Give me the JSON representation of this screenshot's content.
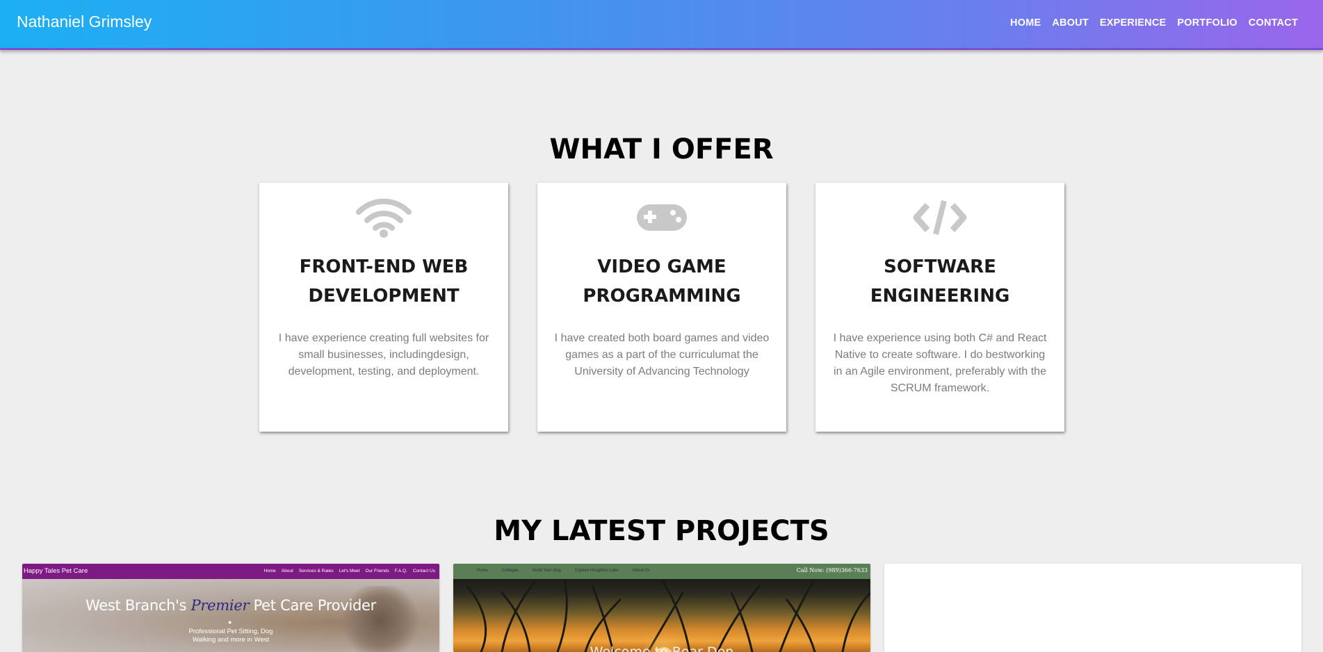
{
  "header": {
    "brand": "Nathaniel Grimsley",
    "nav": [
      "HOME",
      "ABOUT",
      "EXPERIENCE",
      "PORTFOLIO",
      "CONTACT"
    ]
  },
  "offer": {
    "title": "WHAT I OFFER",
    "cards": [
      {
        "icon": "wifi-icon",
        "title_line1": "FRONT-END WEB",
        "title_line2": "DEVELOPMENT",
        "text": "I have experience creating full websites for small businesses, includingdesign, development, testing, and deployment."
      },
      {
        "icon": "gamepad-icon",
        "title_line1": "VIDEO GAME",
        "title_line2": "PROGRAMMING",
        "text": "I have created both board games and video games as a part of the curriculumat the University of Advancing Technology"
      },
      {
        "icon": "code-icon",
        "title_line1": "SOFTWARE",
        "title_line2": "ENGINEERING",
        "text": "I have experience using both C# and React Native to create software. I do bestworking in an Agile environment, preferably with the SCRUM framework."
      }
    ]
  },
  "projects": {
    "title": "MY LATEST PROJECTS",
    "p1": {
      "brand": "Happy Tales Pet Care",
      "nav": [
        "Home",
        "About",
        "Services & Rates",
        "Let's Meet",
        "Our Friends",
        "F.A.Q.",
        "Contact Us"
      ],
      "headline_pre": "West Branch's ",
      "headline_em": "Premier",
      "headline_post": " Pet Care Provider",
      "sub_line1": "Professional Pet Sitting, Dog",
      "sub_line2": "Walking and more in West"
    },
    "p2": {
      "nav": [
        "Home",
        "Cottages",
        "Book Your Stay",
        "Explore Houghton Lake",
        "About Us"
      ],
      "call": "Call Now: (989)366-7633",
      "welcome": "Welcome to Bear Den"
    }
  },
  "colors": {
    "header_gradient_start": "#1cb0f3",
    "header_gradient_end": "#9a66ea",
    "page_background": "#eeeeee",
    "icon_gray": "#c8c8c8",
    "p1_bar": "#7e1a84",
    "p2_bar": "#5a7e56"
  }
}
